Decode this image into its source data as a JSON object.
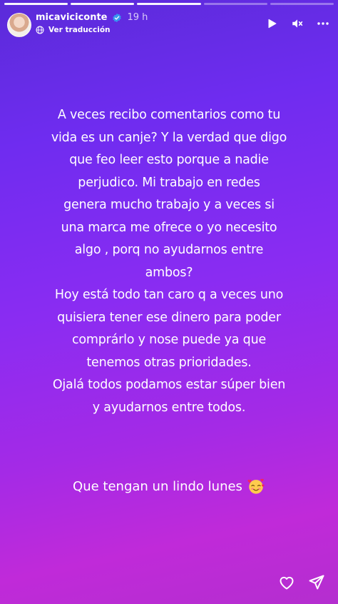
{
  "story": {
    "progress_segments": 5,
    "active_segment": 3
  },
  "header": {
    "username": "micaviciconte",
    "time": "19 h",
    "translate": "Ver traducción"
  },
  "content": {
    "text": "A veces recibo comentarios como tu\nvida es un canje? Y la verdad que digo\nque feo leer esto porque a nadie\nperjudico. Mi trabajo en redes\ngenera mucho trabajo y a veces si\nuna marca me ofrece o yo necesito\nalgo , porq no ayudarnos entre\nambos?\nHoy está todo tan caro q a veces uno\nquisiera tener ese dinero para poder\ncomprárlo y nose puede ya que\ntenemos otras prioridades.\nOjalá todos podamos estar súper bien\ny ayudarnos entre todos.",
    "closing": "Que tengan un lindo lunes"
  },
  "icons": {
    "verified": "verified-badge-icon",
    "translate": "globe-icon",
    "play": "play-icon",
    "mute": "mute-icon",
    "more": "more-options-icon",
    "emoji": "smiling-face-with-hearts",
    "like": "heart-icon",
    "share": "send-icon"
  },
  "colors": {
    "verified": "#3897f0",
    "bg_top": "#5a2bd9",
    "bg_bottom": "#c02ad9"
  }
}
